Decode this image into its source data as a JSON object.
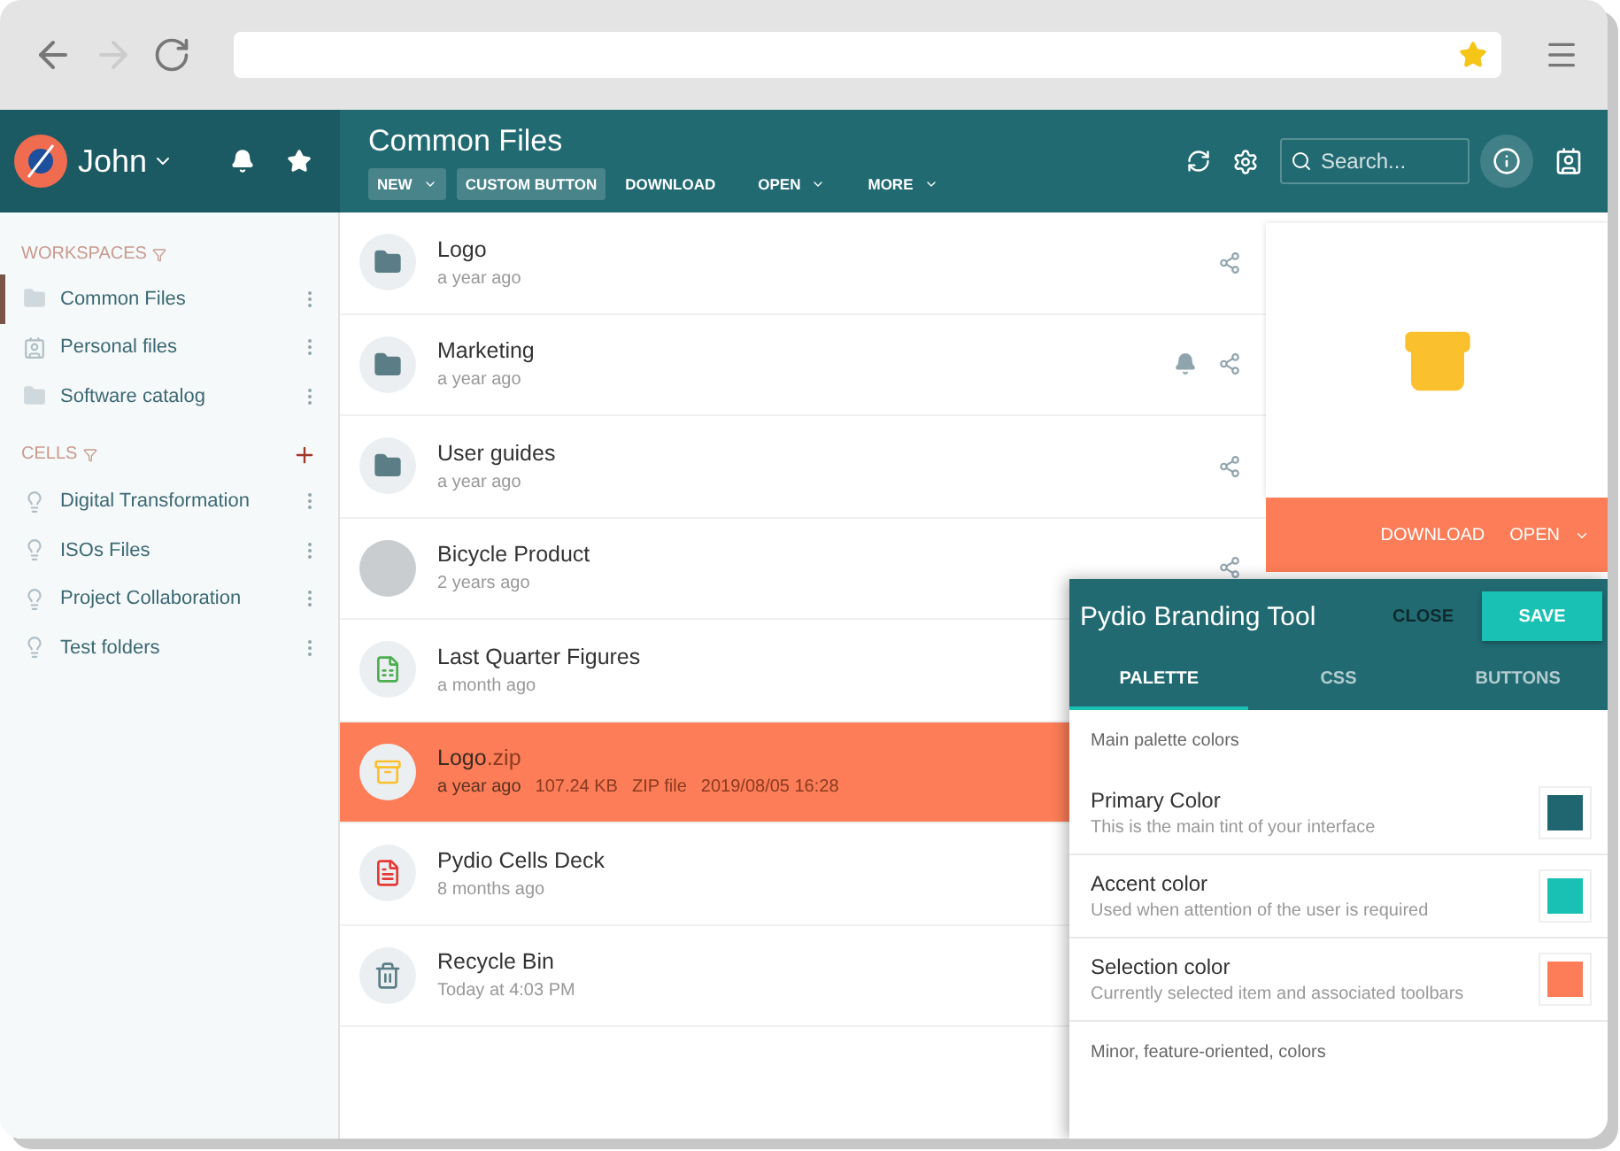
{
  "user": {
    "name": "John"
  },
  "header": {
    "title": "Common Files",
    "buttons": [
      {
        "label": "NEW",
        "filled": true,
        "menu": true
      },
      {
        "label": "CUSTOM BUTTON",
        "filled": true,
        "menu": false
      },
      {
        "label": "DOWNLOAD",
        "filled": false,
        "menu": false
      },
      {
        "label": "OPEN",
        "filled": false,
        "menu": true
      },
      {
        "label": "MORE",
        "filled": false,
        "menu": true
      }
    ],
    "search": {
      "placeholder": "Search..."
    }
  },
  "sidebar": {
    "sections": [
      {
        "title": "WORKSPACES",
        "add": false,
        "items": [
          {
            "label": "Common Files",
            "kind": "folder",
            "selected": true
          },
          {
            "label": "Personal files",
            "kind": "personal",
            "selected": false
          },
          {
            "label": "Software catalog",
            "kind": "folder",
            "selected": false
          }
        ]
      },
      {
        "title": "CELLS",
        "add": true,
        "items": [
          {
            "label": "Digital Transformation",
            "kind": "cell",
            "selected": false
          },
          {
            "label": "ISOs Files",
            "kind": "cell",
            "selected": false
          },
          {
            "label": "Project Collaboration",
            "kind": "cell",
            "selected": false
          },
          {
            "label": "Test folders",
            "kind": "cell",
            "selected": false
          }
        ]
      }
    ]
  },
  "files": [
    {
      "name": "Logo",
      "time": "a year ago",
      "kind": "folder",
      "selected": false,
      "shared": true,
      "watched": false
    },
    {
      "name": "Marketing",
      "time": "a year ago",
      "kind": "folder",
      "selected": false,
      "shared": true,
      "watched": true
    },
    {
      "name": "User guides",
      "time": "a year ago",
      "kind": "folder",
      "selected": false,
      "shared": true,
      "watched": false
    },
    {
      "name": "Bicycle Product",
      "time": "2 years ago",
      "kind": "photo",
      "selected": false,
      "shared": true,
      "watched": false
    },
    {
      "name": "Last Quarter Figures",
      "time": "a month ago",
      "kind": "spreadsheet",
      "selected": false
    },
    {
      "name": "Logo",
      "ext": ".zip",
      "time": "a year ago",
      "meta": [
        "107.24 KB",
        "ZIP file",
        "2019/08/05 16:28"
      ],
      "kind": "archive",
      "selected": true
    },
    {
      "name": "Pydio Cells Deck",
      "time": "8 months ago",
      "kind": "pdf",
      "selected": false
    },
    {
      "name": "Recycle Bin",
      "time": "Today at 4:03 PM",
      "kind": "trash",
      "selected": false
    }
  ],
  "info_panel": {
    "actions": [
      {
        "label": "DOWNLOAD",
        "menu": false
      },
      {
        "label": "OPEN",
        "menu": true
      }
    ]
  },
  "branding_dialog": {
    "title": "Pydio Branding Tool",
    "close": "CLOSE",
    "save": "SAVE",
    "tabs": [
      {
        "label": "PALETTE",
        "selected": true
      },
      {
        "label": "CSS",
        "selected": false
      },
      {
        "label": "BUTTONS",
        "selected": false
      }
    ],
    "sections": [
      {
        "kind": "heading",
        "text": "Main palette colors"
      },
      {
        "kind": "color",
        "title": "Primary Color",
        "description": "This is the main tint of your interface",
        "color": "#1f6670"
      },
      {
        "kind": "color",
        "title": "Accent color",
        "description": "Used when attention of the user is required",
        "color": "#19c1b5"
      },
      {
        "kind": "color",
        "title": "Selection color",
        "description": "Currently selected item and associated toolbars",
        "color": "#fc7d57"
      },
      {
        "kind": "heading",
        "text": "Minor, feature-oriented, colors"
      }
    ]
  }
}
